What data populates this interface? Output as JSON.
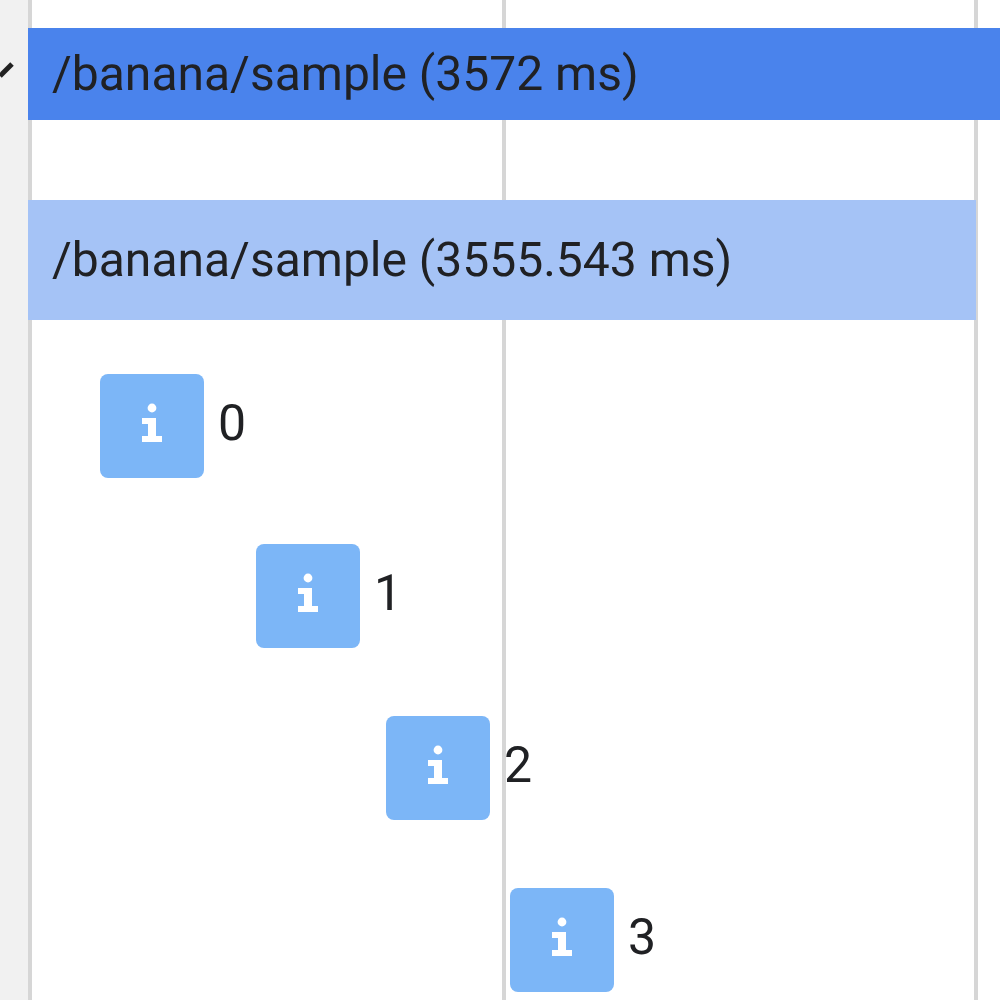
{
  "spans": [
    {
      "label": "/banana/sample (3572 ms)",
      "kind": "selected"
    },
    {
      "label": "/banana/sample (3555.543 ms)",
      "kind": "child"
    }
  ],
  "annotations": [
    {
      "label": "0"
    },
    {
      "label": "1"
    },
    {
      "label": "2"
    },
    {
      "label": "3"
    }
  ]
}
